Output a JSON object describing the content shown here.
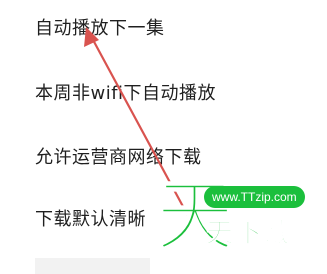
{
  "settings": {
    "items": [
      {
        "label": "自动播放下一集"
      },
      {
        "label": "本周非wifi下自动播放"
      },
      {
        "label": "允许运营商网络下载"
      },
      {
        "label": "下载默认清晰"
      }
    ]
  },
  "watermark": {
    "big_char": "天",
    "url": "www.TTzip.com",
    "brand": "天下载"
  },
  "colors": {
    "text": "#1f1f1f",
    "arrow": "#d9534f",
    "watermark_green": "#1bbf3c"
  }
}
